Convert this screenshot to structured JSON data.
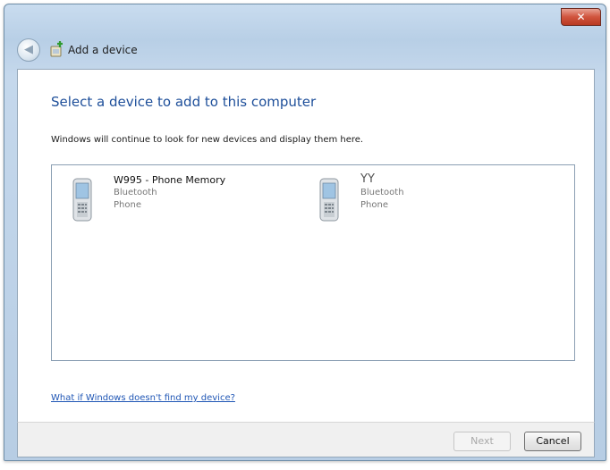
{
  "window": {
    "title": "Add a device",
    "close_glyph": "✕",
    "back_glyph": "◀"
  },
  "main": {
    "heading": "Select a device to add to this computer",
    "instruction": "Windows will continue to look for new devices and display them here.",
    "devices": [
      {
        "name": "W995 - Phone Memory",
        "connection": "Bluetooth",
        "type": "Phone"
      },
      {
        "name": "YY",
        "connection": "Bluetooth",
        "type": "Phone"
      }
    ],
    "help_link": "What if Windows doesn't find my device?"
  },
  "footer": {
    "next_label": "Next",
    "cancel_label": "Cancel"
  },
  "icons": {
    "back": "back-arrow-icon",
    "title": "add-device-icon",
    "device": "phone-icon"
  },
  "colors": {
    "heading": "#1e4f9a",
    "link": "#1f56b5",
    "close": "#d0543d"
  }
}
